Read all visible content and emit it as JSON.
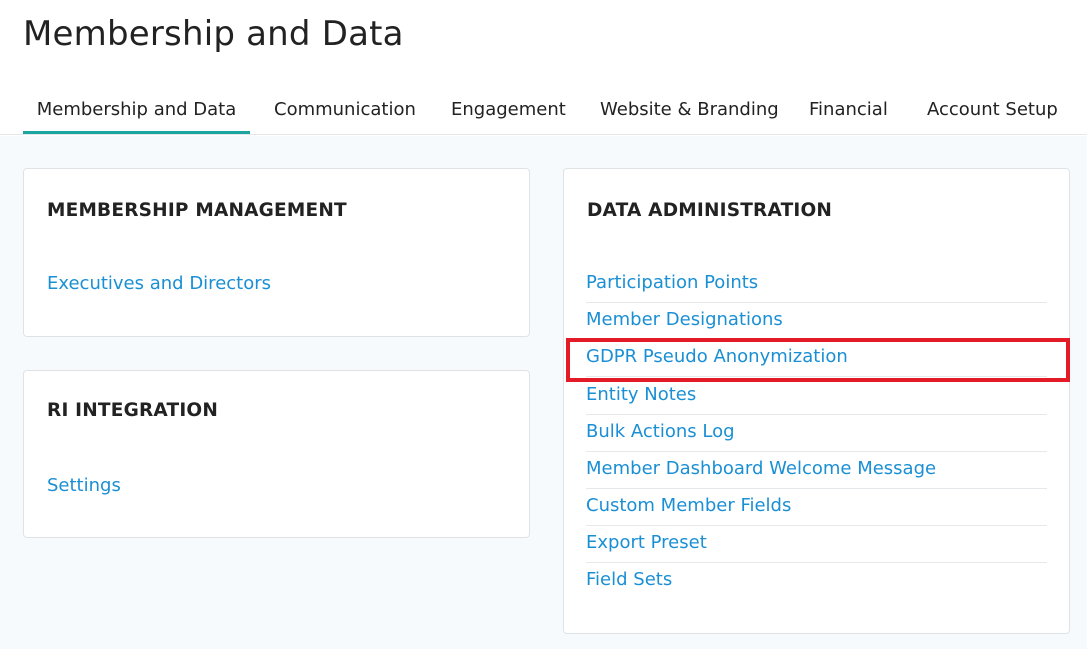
{
  "page": {
    "title": "Membership and Data"
  },
  "tabs": [
    {
      "label": "Membership and Data",
      "active": true
    },
    {
      "label": "Communication",
      "active": false
    },
    {
      "label": "Engagement",
      "active": false
    },
    {
      "label": "Website & Branding",
      "active": false
    },
    {
      "label": "Financial",
      "active": false
    },
    {
      "label": "Account Setup",
      "active": false
    }
  ],
  "membership_management": {
    "title": "MEMBERSHIP MANAGEMENT",
    "links": [
      "Executives and Directors"
    ]
  },
  "ri_integration": {
    "title": "RI INTEGRATION",
    "links": [
      "Settings"
    ]
  },
  "data_administration": {
    "title": "DATA ADMINISTRATION",
    "links": [
      "Participation Points",
      "Member Designations",
      "GDPR Pseudo Anonymization",
      "Entity Notes",
      "Bulk Actions Log",
      "Member Dashboard Welcome Message",
      "Custom Member Fields",
      "Export Preset",
      "Field Sets"
    ],
    "highlighted_link": "GDPR Pseudo Anonymization"
  },
  "colors": {
    "accent": "#1aa5a0",
    "link": "#1a8fd4",
    "highlight": "#e21b26"
  }
}
